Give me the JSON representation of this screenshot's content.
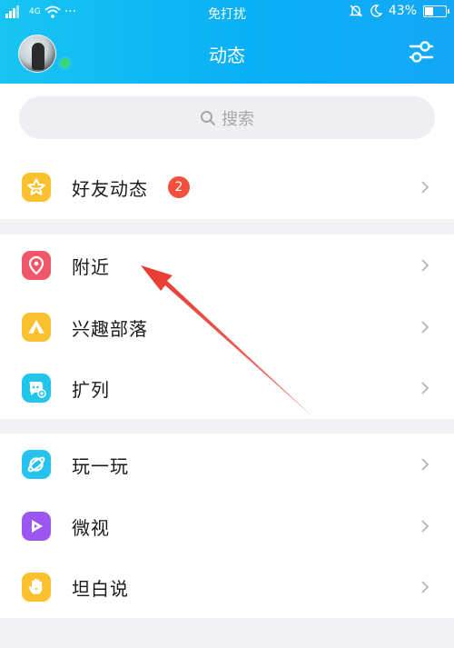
{
  "status_bar": {
    "signal_text": "4G",
    "dots": "···",
    "center": "免打扰",
    "battery_percent": "43%",
    "battery_level": 0.43
  },
  "header": {
    "title": "动态",
    "avatar_icon": "user-avatar",
    "settings_icon": "sliders-icon"
  },
  "search": {
    "placeholder": "搜索",
    "icon": "search-icon"
  },
  "sections": [
    {
      "items": [
        {
          "label": "好友动态",
          "icon": "star-icon",
          "color": "#fbc02d",
          "badge": "2"
        }
      ]
    },
    {
      "items": [
        {
          "label": "附近",
          "icon": "location-pin-icon",
          "color": "#f0576a"
        },
        {
          "label": "兴趣部落",
          "icon": "tent-icon",
          "color": "#fbc02d"
        },
        {
          "label": "扩列",
          "icon": "chat-plus-icon",
          "color": "#22c6ec"
        }
      ]
    },
    {
      "items": [
        {
          "label": "玩一玩",
          "icon": "planet-icon",
          "color": "#27c2ef"
        },
        {
          "label": "微视",
          "icon": "play-icon",
          "color": "#9b57f0"
        },
        {
          "label": "坦白说",
          "icon": "hand-icon",
          "color": "#fbc02d"
        }
      ]
    }
  ],
  "colors": {
    "header_gradient_start": "#17c5f2",
    "header_gradient_end": "#14a7f5",
    "badge": "#f0503c",
    "annotation_arrow": "#e8392f"
  }
}
